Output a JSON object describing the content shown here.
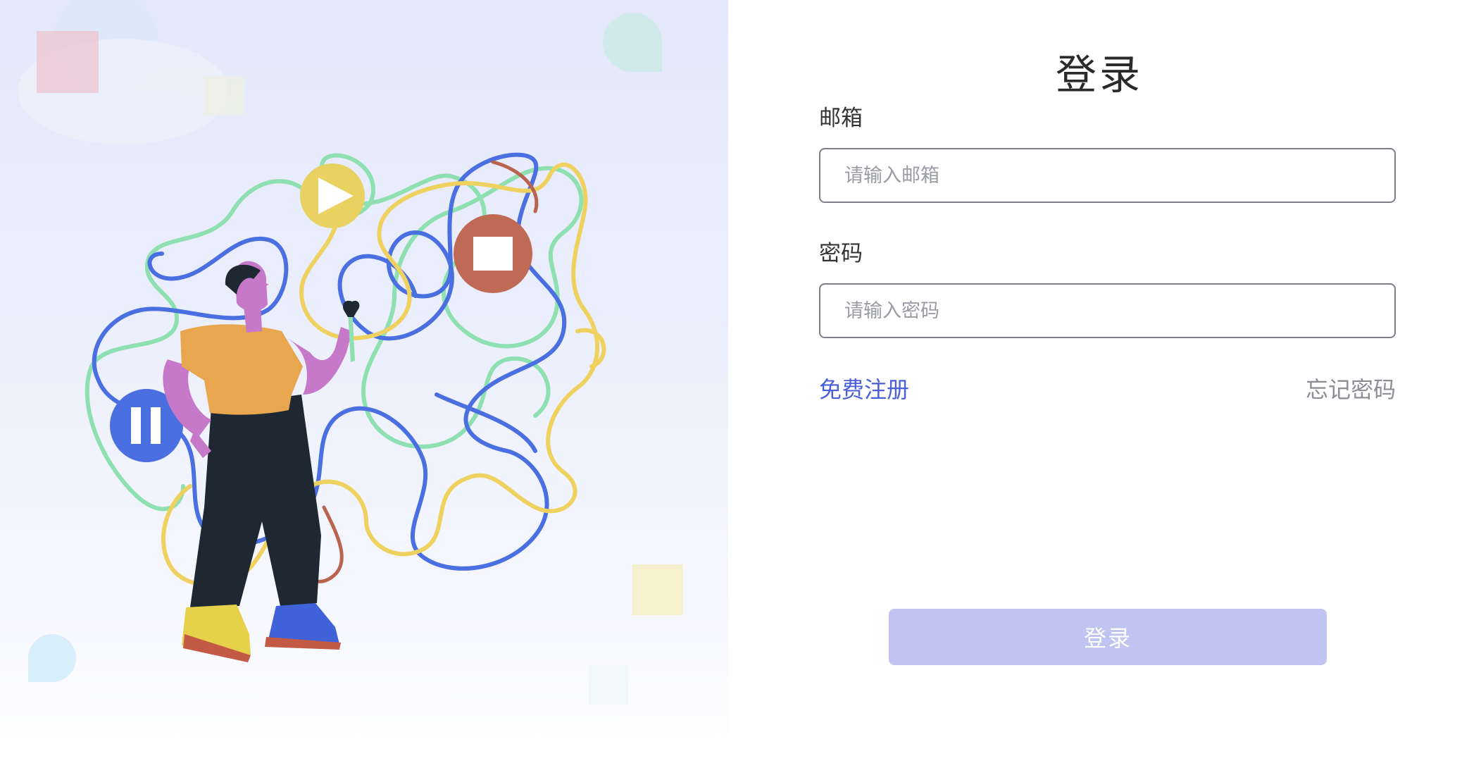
{
  "hero": {
    "illustration": "person-holding-wrench-with-tangled-lines",
    "icons": [
      "play-icon",
      "stop-icon",
      "pause-icon"
    ],
    "colors": {
      "background_top": "#e3e8fb",
      "line_blue": "#4a6fe0",
      "line_green": "#8fe0b0",
      "line_yellow": "#efd160",
      "line_brown": "#b8644f",
      "shirt": "#e8a64f",
      "skin": "#c679c8",
      "pants": "#1e2832"
    }
  },
  "form": {
    "title": "登录",
    "email": {
      "label": "邮箱",
      "placeholder": "请输入邮箱",
      "value": ""
    },
    "password": {
      "label": "密码",
      "placeholder": "请输入密码",
      "value": ""
    },
    "register_link": "免费注册",
    "forgot_link": "忘记密码",
    "submit_label": "登录",
    "colors": {
      "link": "#4a5fd8",
      "muted_link": "#8c8e94",
      "button_disabled": "#bfc5f0"
    }
  }
}
